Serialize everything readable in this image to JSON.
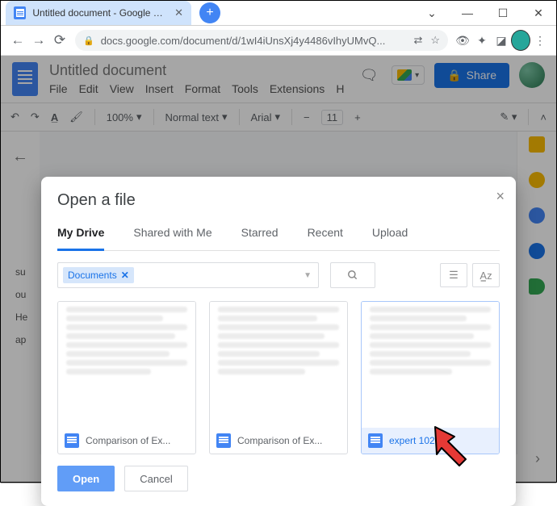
{
  "browser": {
    "tab_title": "Untitled document - Google Do...",
    "url": "docs.google.com/document/d/1wI4iUnsXj4y4486vIhyUMvQ...",
    "new_tab_label": "+"
  },
  "docs": {
    "title": "Untitled document",
    "menu": [
      "File",
      "Edit",
      "View",
      "Insert",
      "Format",
      "Tools",
      "Extensions",
      "H"
    ],
    "share_label": "Share",
    "toolbar": {
      "zoom": "100%",
      "style": "Normal text",
      "font": "Arial",
      "size": "11"
    }
  },
  "left_text": {
    "l1": "su",
    "l2": "ou",
    "l3": "He",
    "l4": "ap"
  },
  "modal": {
    "title": "Open a file",
    "tabs": {
      "mydrive": "My Drive",
      "shared": "Shared with Me",
      "starred": "Starred",
      "recent": "Recent",
      "upload": "Upload"
    },
    "filter_chip": "Documents",
    "files": [
      {
        "name": "Comparison of Ex..."
      },
      {
        "name": "Comparison of Ex..."
      },
      {
        "name": "expert 102"
      }
    ],
    "open_label": "Open",
    "cancel_label": "Cancel"
  }
}
